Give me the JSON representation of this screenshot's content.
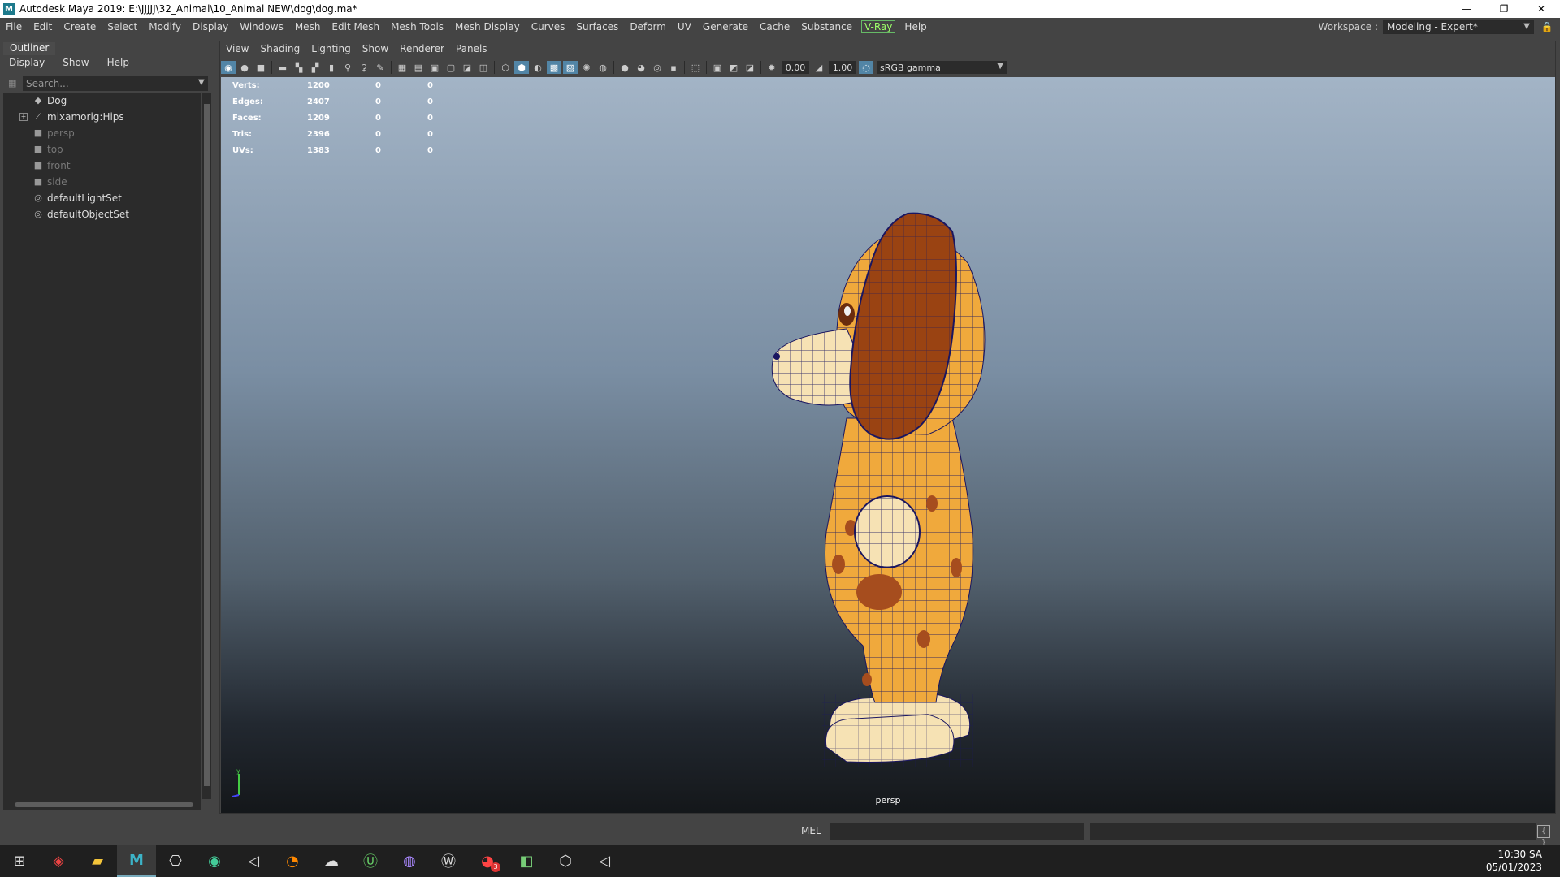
{
  "window": {
    "title": "Autodesk Maya 2019: E:\\JJJJJ\\32_Animal\\10_Animal NEW\\dog\\dog.ma*",
    "app_icon": "M",
    "minimize": "—",
    "restore": "❐",
    "close": "✕"
  },
  "menubar": {
    "items": [
      "File",
      "Edit",
      "Create",
      "Select",
      "Modify",
      "Display",
      "Windows",
      "Mesh",
      "Edit Mesh",
      "Mesh Tools",
      "Mesh Display",
      "Curves",
      "Surfaces",
      "Deform",
      "UV",
      "Generate",
      "Cache",
      "Substance",
      "V-Ray",
      "Help"
    ],
    "workspace_label": "Workspace :",
    "workspace_value": "Modeling - Expert*"
  },
  "outliner": {
    "tab": "Outliner",
    "menu": [
      "Display",
      "Show",
      "Help"
    ],
    "search_placeholder": "Search...",
    "items": [
      {
        "label": "Dog",
        "icon": "mesh-icon",
        "glyph": "◆",
        "dim": false,
        "expandable": false
      },
      {
        "label": "mixamorig:Hips",
        "icon": "joint-icon",
        "glyph": "⟋",
        "dim": false,
        "expandable": true
      },
      {
        "label": "persp",
        "icon": "camera-icon",
        "glyph": "■",
        "dim": true,
        "expandable": false
      },
      {
        "label": "top",
        "icon": "camera-icon",
        "glyph": "■",
        "dim": true,
        "expandable": false
      },
      {
        "label": "front",
        "icon": "camera-icon",
        "glyph": "■",
        "dim": true,
        "expandable": false
      },
      {
        "label": "side",
        "icon": "camera-icon",
        "glyph": "■",
        "dim": true,
        "expandable": false
      },
      {
        "label": "defaultLightSet",
        "icon": "set-icon",
        "glyph": "◎",
        "dim": false,
        "expandable": false
      },
      {
        "label": "defaultObjectSet",
        "icon": "set-icon",
        "glyph": "◎",
        "dim": false,
        "expandable": false
      }
    ]
  },
  "viewport": {
    "menu": [
      "View",
      "Shading",
      "Lighting",
      "Show",
      "Renderer",
      "Panels"
    ],
    "exposure": "0.00",
    "gamma": "1.00",
    "color_space": "sRGB gamma",
    "camera": "persp",
    "hud": [
      {
        "label": "Verts:",
        "v1": "1200",
        "v2": "0",
        "v3": "0"
      },
      {
        "label": "Edges:",
        "v1": "2407",
        "v2": "0",
        "v3": "0"
      },
      {
        "label": "Faces:",
        "v1": "1209",
        "v2": "0",
        "v3": "0"
      },
      {
        "label": "Tris:",
        "v1": "2396",
        "v2": "0",
        "v3": "0"
      },
      {
        "label": "UVs:",
        "v1": "1383",
        "v2": "0",
        "v3": "0"
      }
    ],
    "colors": {
      "body": "#f0a93c",
      "ear": "#9a4312",
      "spot": "#a64d1e",
      "cream": "#f6e2b4",
      "wire": "#1a1660"
    }
  },
  "cmdline": {
    "mel_label": "MEL"
  },
  "taskbar": {
    "icons": [
      "windows-start-icon",
      "sketchup-icon",
      "file-explorer-icon",
      "maya-icon",
      "photoshop-like-icon",
      "chrome-icon",
      "unity-icon",
      "blender-icon",
      "substance-icon",
      "upwork-icon",
      "github-icon",
      "wordpress-icon",
      "messenger-icon",
      "cura-icon",
      "unity-hub-icon",
      "unity-editor-icon"
    ],
    "badge": "3",
    "time": "10:30 SA",
    "date": "05/01/2023"
  }
}
